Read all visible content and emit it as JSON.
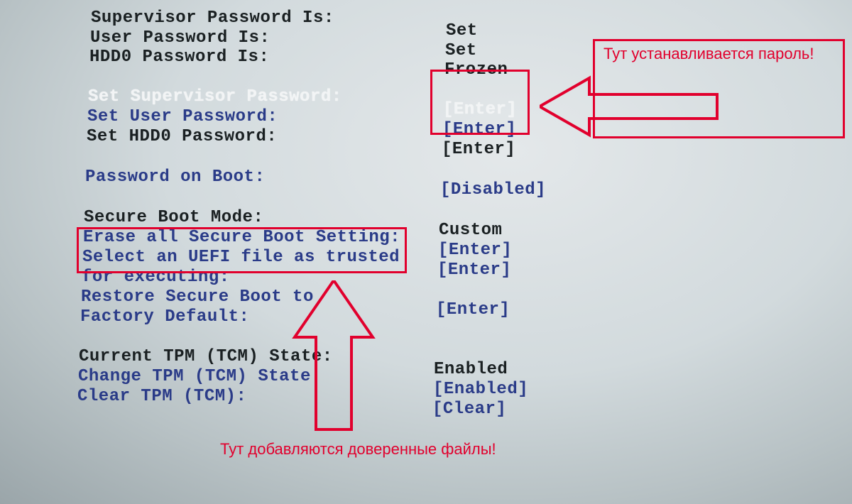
{
  "rows": {
    "r0": {
      "label": "Supervisor Password Is:",
      "value": "Set",
      "lcolor": "black",
      "vcolor": "black"
    },
    "r1": {
      "label": "User Password Is:",
      "value": "Set",
      "lcolor": "black",
      "vcolor": "black"
    },
    "r2": {
      "label": "HDD0 Password Is:",
      "value": "Frozen",
      "lcolor": "black",
      "vcolor": "black"
    },
    "r4": {
      "label": "Set Supervisor Password:",
      "value": "[Enter]",
      "lcolor": "white",
      "vcolor": "white"
    },
    "r5": {
      "label": "Set User Password:",
      "value": "[Enter]",
      "lcolor": "blue",
      "vcolor": "blue"
    },
    "r6": {
      "label": "Set HDD0 Password:",
      "value": "[Enter]",
      "lcolor": "black",
      "vcolor": "black"
    },
    "r8": {
      "label": "Password on Boot:",
      "value": "[Disabled]",
      "lcolor": "blue",
      "vcolor": "blue"
    },
    "r10": {
      "label": "Secure Boot Mode:",
      "value": "Custom",
      "lcolor": "black",
      "vcolor": "black"
    },
    "r11": {
      "label": "Erase all Secure Boot Setting:",
      "value": "[Enter]",
      "lcolor": "blue",
      "vcolor": "blue"
    },
    "r12": {
      "label": "Select an UEFI file as trusted",
      "value": "[Enter]",
      "lcolor": "blue",
      "vcolor": "blue"
    },
    "r13": {
      "label": "for executing:",
      "value": "",
      "lcolor": "blue",
      "vcolor": "blue"
    },
    "r14": {
      "label": "Restore Secure Boot to",
      "value": "[Enter]",
      "lcolor": "blue",
      "vcolor": "blue"
    },
    "r15": {
      "label": "Factory Default:",
      "value": "",
      "lcolor": "blue",
      "vcolor": "blue"
    },
    "r17": {
      "label": "Current TPM (TCM) State:",
      "value": "Enabled",
      "lcolor": "black",
      "vcolor": "black"
    },
    "r18": {
      "label": "Change TPM (TCM) State:",
      "value": "[Enabled]",
      "lcolor": "blue",
      "vcolor": "blue"
    },
    "r19": {
      "label": "Clear TPM (TCM):",
      "value": "[Clear]",
      "lcolor": "blue",
      "vcolor": "blue"
    }
  },
  "annotations": {
    "top_right": "Тут устанавливается пароль!",
    "bottom": "Тут добавляются доверенные файлы!"
  },
  "colors": {
    "annot": "#e1002d"
  }
}
